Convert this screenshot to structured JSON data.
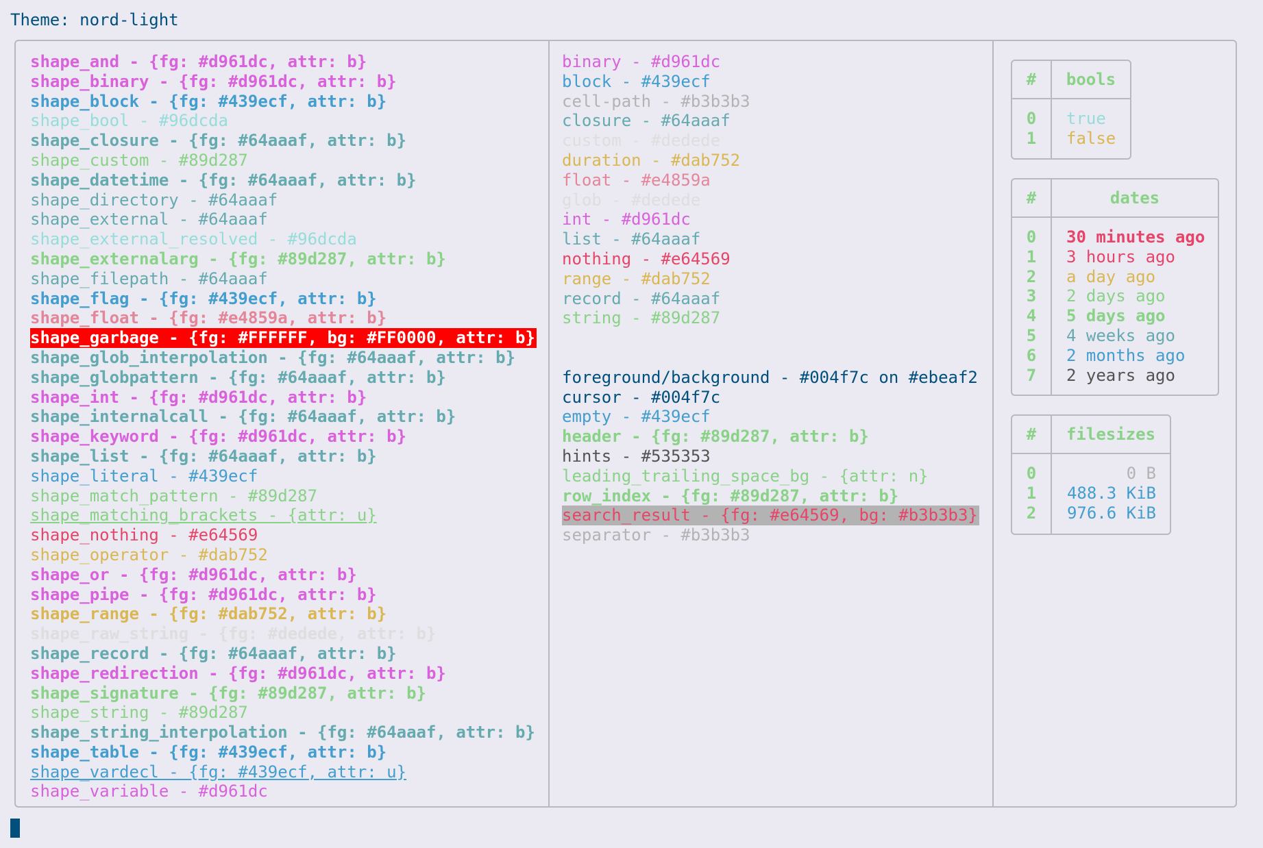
{
  "title": "Theme: nord-light",
  "shapes": [
    {
      "text": "shape_and - {fg: #d961dc, attr: b}",
      "color": "#d961dc",
      "bold": true
    },
    {
      "text": "shape_binary - {fg: #d961dc, attr: b}",
      "color": "#d961dc",
      "bold": true
    },
    {
      "text": "shape_block - {fg: #439ecf, attr: b}",
      "color": "#439ecf",
      "bold": true
    },
    {
      "text": "shape_bool - #96dcda",
      "color": "#96dcda"
    },
    {
      "text": "shape_closure - {fg: #64aaaf, attr: b}",
      "color": "#64aaaf",
      "bold": true
    },
    {
      "text": "shape_custom - #89d287",
      "color": "#89d287"
    },
    {
      "text": "shape_datetime - {fg: #64aaaf, attr: b}",
      "color": "#64aaaf",
      "bold": true
    },
    {
      "text": "shape_directory - #64aaaf",
      "color": "#64aaaf"
    },
    {
      "text": "shape_external - #64aaaf",
      "color": "#64aaaf"
    },
    {
      "text": "shape_external_resolved - #96dcda",
      "color": "#96dcda"
    },
    {
      "text": "shape_externalarg - {fg: #89d287, attr: b}",
      "color": "#89d287",
      "bold": true
    },
    {
      "text": "shape_filepath - #64aaaf",
      "color": "#64aaaf"
    },
    {
      "text": "shape_flag - {fg: #439ecf, attr: b}",
      "color": "#439ecf",
      "bold": true
    },
    {
      "text": "shape_float - {fg: #e4859a, attr: b}",
      "color": "#e4859a",
      "bold": true
    },
    {
      "text": "shape_garbage - {fg: #FFFFFF, bg: #FF0000, attr: b}",
      "color": "#FFFFFF",
      "bg": "#FF0000",
      "bold": true
    },
    {
      "text": "shape_glob_interpolation - {fg: #64aaaf, attr: b}",
      "color": "#64aaaf",
      "bold": true
    },
    {
      "text": "shape_globpattern - {fg: #64aaaf, attr: b}",
      "color": "#64aaaf",
      "bold": true
    },
    {
      "text": "shape_int - {fg: #d961dc, attr: b}",
      "color": "#d961dc",
      "bold": true
    },
    {
      "text": "shape_internalcall - {fg: #64aaaf, attr: b}",
      "color": "#64aaaf",
      "bold": true
    },
    {
      "text": "shape_keyword - {fg: #d961dc, attr: b}",
      "color": "#d961dc",
      "bold": true
    },
    {
      "text": "shape_list - {fg: #64aaaf, attr: b}",
      "color": "#64aaaf",
      "bold": true
    },
    {
      "text": "shape_literal - #439ecf",
      "color": "#439ecf"
    },
    {
      "text": "shape_match_pattern - #89d287",
      "color": "#89d287"
    },
    {
      "text": "shape_matching_brackets - {attr: u}",
      "color": "#89d287",
      "underline": true
    },
    {
      "text": "shape_nothing - #e64569",
      "color": "#e64569"
    },
    {
      "text": "shape_operator - #dab752",
      "color": "#dab752"
    },
    {
      "text": "shape_or - {fg: #d961dc, attr: b}",
      "color": "#d961dc",
      "bold": true
    },
    {
      "text": "shape_pipe - {fg: #d961dc, attr: b}",
      "color": "#d961dc",
      "bold": true
    },
    {
      "text": "shape_range - {fg: #dab752, attr: b}",
      "color": "#dab752",
      "bold": true
    },
    {
      "text": "shape_raw_string - {fg: #dedede, attr: b}",
      "color": "#dedede",
      "bold": true
    },
    {
      "text": "shape_record - {fg: #64aaaf, attr: b}",
      "color": "#64aaaf",
      "bold": true
    },
    {
      "text": "shape_redirection - {fg: #d961dc, attr: b}",
      "color": "#d961dc",
      "bold": true
    },
    {
      "text": "shape_signature - {fg: #89d287, attr: b}",
      "color": "#89d287",
      "bold": true
    },
    {
      "text": "shape_string - #89d287",
      "color": "#89d287"
    },
    {
      "text": "shape_string_interpolation - {fg: #64aaaf, attr: b}",
      "color": "#64aaaf",
      "bold": true
    },
    {
      "text": "shape_table - {fg: #439ecf, attr: b}",
      "color": "#439ecf",
      "bold": true
    },
    {
      "text": "shape_vardecl - {fg: #439ecf, attr: u}",
      "color": "#439ecf",
      "underline": true
    },
    {
      "text": "shape_variable - #d961dc",
      "color": "#d961dc"
    }
  ],
  "types": [
    {
      "text": "binary - #d961dc",
      "color": "#d961dc"
    },
    {
      "text": "block - #439ecf",
      "color": "#439ecf"
    },
    {
      "text": "cell-path - #b3b3b3",
      "color": "#b3b3b3"
    },
    {
      "text": "closure - #64aaaf",
      "color": "#64aaaf"
    },
    {
      "text": "custom - #dedede",
      "color": "#dedede"
    },
    {
      "text": "duration - #dab752",
      "color": "#dab752"
    },
    {
      "text": "float - #e4859a",
      "color": "#e4859a"
    },
    {
      "text": "glob - #dedede",
      "color": "#dedede"
    },
    {
      "text": "int - #d961dc",
      "color": "#d961dc"
    },
    {
      "text": "list - #64aaaf",
      "color": "#64aaaf"
    },
    {
      "text": "nothing - #e64569",
      "color": "#e64569"
    },
    {
      "text": "range - #dab752",
      "color": "#dab752"
    },
    {
      "text": "record - #64aaaf",
      "color": "#64aaaf"
    },
    {
      "text": "string - #89d287",
      "color": "#89d287"
    }
  ],
  "ui": [
    {
      "text": "foreground/background - #004f7c on #ebeaf2",
      "color": "#004f7c"
    },
    {
      "text": "cursor - #004f7c",
      "color": "#004f7c"
    },
    {
      "text": "empty - #439ecf",
      "color": "#439ecf"
    },
    {
      "text": "header - {fg: #89d287, attr: b}",
      "color": "#89d287",
      "bold": true
    },
    {
      "text": "hints - #535353",
      "color": "#535353"
    },
    {
      "text": "leading_trailing_space_bg - {attr: n}",
      "color": "#89d287"
    },
    {
      "text": "row_index - {fg: #89d287, attr: b}",
      "color": "#89d287",
      "bold": true
    },
    {
      "text": "search_result - {fg: #e64569, bg: #b3b3b3}",
      "color": "#e64569",
      "bg": "#b3b3b3"
    },
    {
      "text": "separator - #b3b3b3",
      "color": "#b3b3b3"
    }
  ],
  "tables": {
    "bools": {
      "hash": "#",
      "title": "bools",
      "rows": [
        {
          "idx": "0",
          "value": "true",
          "color": "#96dcda"
        },
        {
          "idx": "1",
          "value": "false",
          "color": "#dab752"
        }
      ]
    },
    "dates": {
      "hash": "#",
      "title": "dates",
      "rows": [
        {
          "idx": "0",
          "value": "30 minutes ago",
          "color": "#e64569",
          "bold": true
        },
        {
          "idx": "1",
          "value": "3 hours ago",
          "color": "#e64569"
        },
        {
          "idx": "2",
          "value": "a day ago",
          "color": "#dab752"
        },
        {
          "idx": "3",
          "value": "2 days ago",
          "color": "#89d287"
        },
        {
          "idx": "4",
          "value": "5 days ago",
          "color": "#89d287",
          "bold": true
        },
        {
          "idx": "5",
          "value": "4 weeks ago",
          "color": "#64aaaf"
        },
        {
          "idx": "6",
          "value": "2 months ago",
          "color": "#439ecf"
        },
        {
          "idx": "7",
          "value": "2 years ago",
          "color": "#535353"
        }
      ]
    },
    "filesizes": {
      "hash": "#",
      "title": "filesizes",
      "rows": [
        {
          "idx": "0",
          "value": "0 B",
          "color": "#b3b3b3"
        },
        {
          "idx": "1",
          "value": "488.3 KiB",
          "color": "#439ecf"
        },
        {
          "idx": "2",
          "value": "976.6 KiB",
          "color": "#439ecf"
        }
      ]
    }
  }
}
